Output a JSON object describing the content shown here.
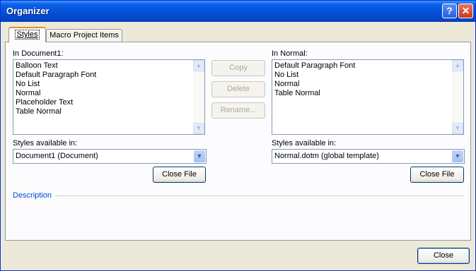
{
  "window": {
    "title": "Organizer",
    "help_glyph": "?",
    "close_glyph": "✕"
  },
  "tabs": [
    {
      "label": "Styles"
    },
    {
      "label": "Macro Project Items"
    }
  ],
  "left": {
    "list_label": "In Document1:",
    "items": [
      "Balloon Text",
      "Default Paragraph Font",
      "No List",
      "Normal",
      "Placeholder Text",
      "Table Normal"
    ],
    "available_label": "Styles available in:",
    "available_value": "Document1 (Document)",
    "close_file": "Close File"
  },
  "right": {
    "list_label": "In Normal:",
    "items": [
      "Default Paragraph Font",
      "No List",
      "Normal",
      "Table Normal"
    ],
    "available_label": "Styles available in:",
    "available_value": "Normal.dotm (global template)",
    "close_file": "Close File"
  },
  "actions": {
    "copy": "Copy",
    "delete": "Delete",
    "rename": "Rename..."
  },
  "description_label": "Description",
  "close_button": "Close",
  "scroll": {
    "up": "▲",
    "down": "▼",
    "dropdown": "▼"
  },
  "colors": {
    "description_text": "#0046d5",
    "title_bar": "#0553d9"
  }
}
